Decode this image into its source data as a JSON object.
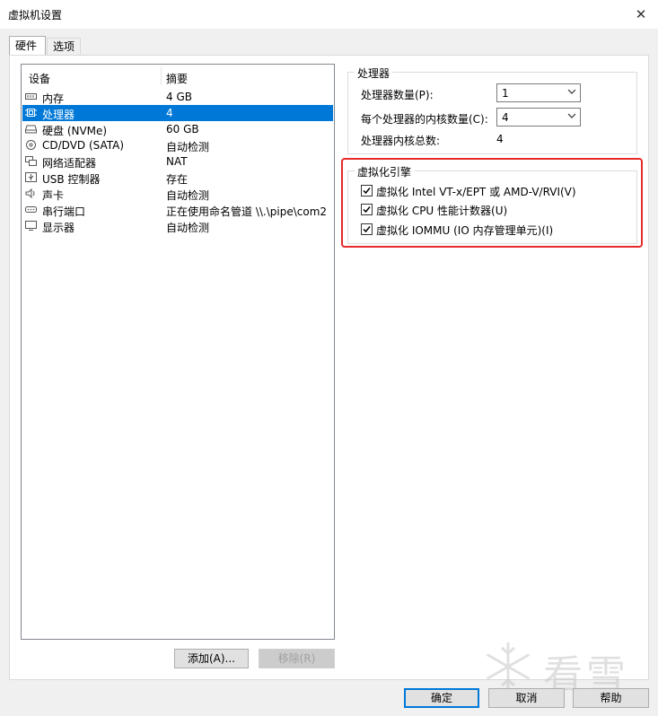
{
  "window": {
    "title": "虚拟机设置",
    "close_glyph": "✕"
  },
  "tabs": [
    {
      "label": "硬件",
      "active": true
    },
    {
      "label": "选项",
      "active": false
    }
  ],
  "devices": {
    "col_device": "设备",
    "col_summary": "摘要",
    "rows": [
      {
        "name": "内存",
        "summary": "4 GB",
        "icon": "memory-icon",
        "selected": false
      },
      {
        "name": "处理器",
        "summary": "4",
        "icon": "processor-icon",
        "selected": true
      },
      {
        "name": "硬盘 (NVMe)",
        "summary": "60 GB",
        "icon": "hard-disk-icon",
        "selected": false
      },
      {
        "name": "CD/DVD (SATA)",
        "summary": "自动检测",
        "icon": "cd-dvd-icon",
        "selected": false
      },
      {
        "name": "网络适配器",
        "summary": "NAT",
        "icon": "network-adapter-icon",
        "selected": false
      },
      {
        "name": "USB 控制器",
        "summary": "存在",
        "icon": "usb-controller-icon",
        "selected": false
      },
      {
        "name": "声卡",
        "summary": "自动检测",
        "icon": "sound-card-icon",
        "selected": false
      },
      {
        "name": "串行端口",
        "summary": "正在使用命名管道 \\\\.\\pipe\\com2",
        "icon": "serial-port-icon",
        "selected": false
      },
      {
        "name": "显示器",
        "summary": "自动检测",
        "icon": "display-icon",
        "selected": false
      }
    ]
  },
  "processor": {
    "group_title": "处理器",
    "count_label": "处理器数量(P):",
    "count_value": "1",
    "cores_label": "每个处理器的内核数量(C):",
    "cores_value": "4",
    "total_label": "处理器内核总数:",
    "total_value": "4"
  },
  "virtualization": {
    "group_title": "虚拟化引擎",
    "options": [
      {
        "label": "虚拟化 Intel VT-x/EPT 或 AMD-V/RVI(V)",
        "checked": true
      },
      {
        "label": "虚拟化 CPU 性能计数器(U)",
        "checked": true
      },
      {
        "label": "虚拟化 IOMMU (IO 内存管理单元)(I)",
        "checked": true
      }
    ]
  },
  "buttons": {
    "add": "添加(A)...",
    "remove": "移除(R)",
    "ok": "确定",
    "cancel": "取消",
    "help": "帮助"
  },
  "watermark": {
    "text": "看雪"
  },
  "colors": {
    "selection": "#0078d7",
    "highlight_border": "#e52a2a"
  }
}
